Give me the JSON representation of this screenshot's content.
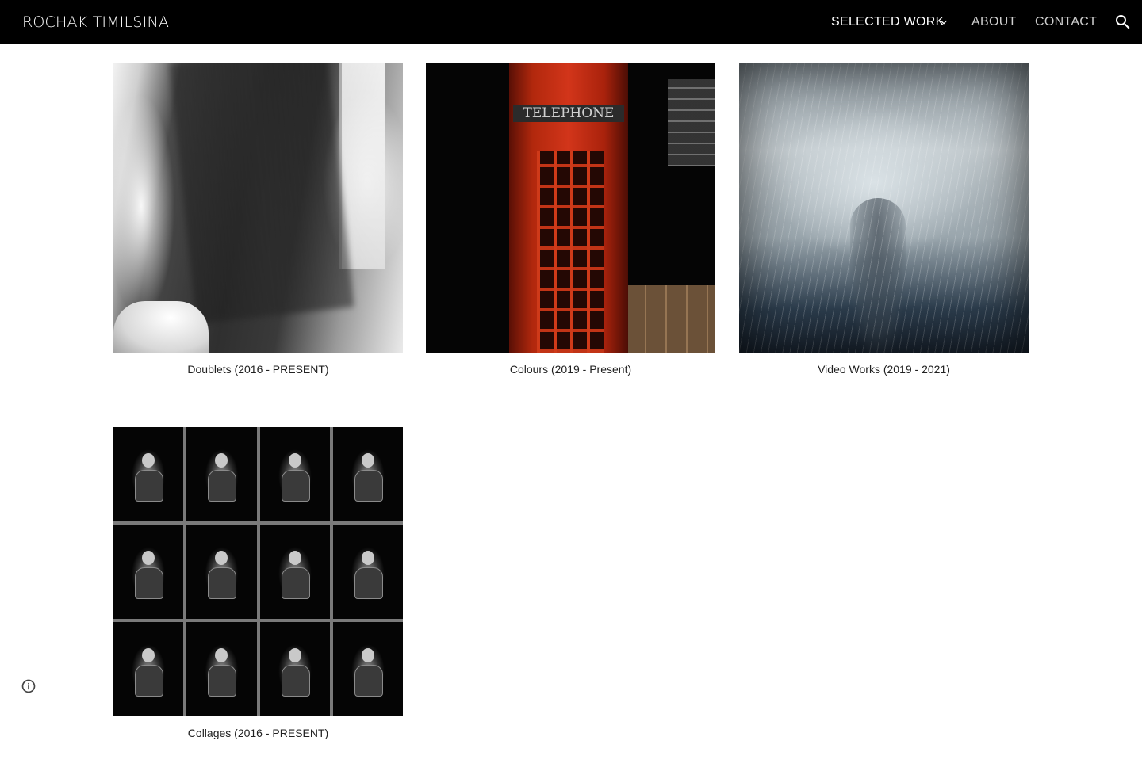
{
  "header": {
    "site_title": "ROCHAK TIMILSINA",
    "nav": {
      "selected_work": "SELECTED WORK",
      "about": "ABOUT",
      "contact": "CONTACT"
    },
    "icons": [
      "chevron-down-icon",
      "search-icon"
    ]
  },
  "gallery": {
    "items": [
      {
        "caption": "Doublets (2016 - PRESENT)"
      },
      {
        "caption": "Colours (2019 - Present)"
      },
      {
        "caption": "Video Works (2019 - 2021)"
      },
      {
        "caption": "Collages (2016 - PRESENT)"
      }
    ]
  },
  "images": {
    "colours_sign": "TELEPHONE"
  },
  "footer": {
    "icon": "info-icon"
  },
  "colors": {
    "header_bg": "#000000",
    "page_bg": "#ffffff",
    "caption_text": "#212121"
  }
}
